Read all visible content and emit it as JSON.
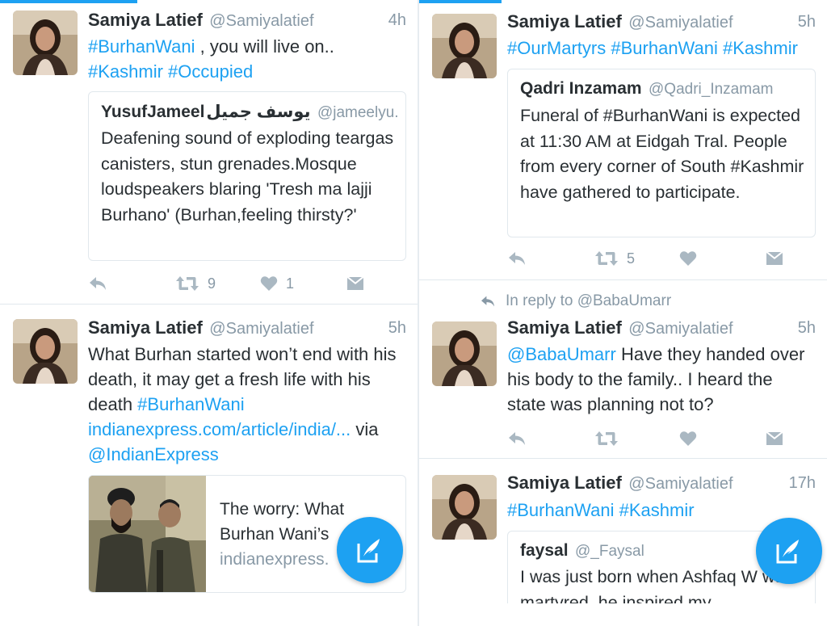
{
  "left": {
    "tweets": [
      {
        "name": "Samiya Latief",
        "handle": "@Samiyalatief",
        "time": "4h",
        "text_tag1": "#BurhanWani",
        "text_mid": " , you will live on..",
        "text_tag2": "#Kashmir",
        "text_tag3": "#Occupied",
        "quote": {
          "name": "YusufJameel",
          "name_urdu": "یوسف جمیل",
          "handle": "@jameelyu...",
          "text": "Deafening sound of exploding teargas canisters, stun grenades.Mosque loudspeakers blaring 'Tresh ma lajji Burhano' (Burhan,feeling thirsty?'"
        },
        "retweets": "9",
        "likes": "1"
      },
      {
        "name": "Samiya Latief",
        "handle": "@Samiyalatief",
        "time": "5h",
        "text_plain": "What Burhan started won’t end with his death, it may get a fresh life with his death ",
        "text_tag": "#BurhanWani",
        "text_link": "indianexpress.com/article/india/...",
        "text_via": " via ",
        "text_mention": "@IndianExpress",
        "card": {
          "title": "The worry: What Burhan Wani’s",
          "url": "indianexpress."
        }
      }
    ]
  },
  "right": {
    "tweets": [
      {
        "name": "Samiya Latief",
        "handle": "@Samiyalatief",
        "time": "5h",
        "tag1": "#OurMartyrs",
        "tag2": "#BurhanWani",
        "tag3": "#Kashmir",
        "quote": {
          "name": "Qadri Inzamam",
          "handle": "@Qadri_Inzamam",
          "text_a": "Funeral of ",
          "text_tag": "#BurhanWani",
          "text_b": " is expected at 11:30 AM at Eidgah Tral. People from every corner of South ",
          "text_tag2": "#Kashmir",
          "text_c": " have gathered to participate."
        },
        "retweets": "5"
      },
      {
        "reply_context": "In reply to @BabaUmarr",
        "name": "Samiya Latief",
        "handle": "@Samiyalatief",
        "time": "5h",
        "mention": "@BabaUmarr",
        "text": " Have they handed over his body to the family.. I heard the state was planning not to?"
      },
      {
        "name": "Samiya Latief",
        "handle": "@Samiyalatief",
        "time": "17h",
        "tag1": "#BurhanWani",
        "tag2": "#Kashmir",
        "quote": {
          "name": "faysal",
          "handle": "@_Faysal",
          "text": "I was just born when Ashfaq W was martyred, he inspired my"
        }
      }
    ]
  },
  "colors": {
    "accent": "#1da1f2",
    "muted": "#8899a6",
    "text": "#292f33",
    "border": "#e1e8ed",
    "icon": "#aab8c2"
  }
}
